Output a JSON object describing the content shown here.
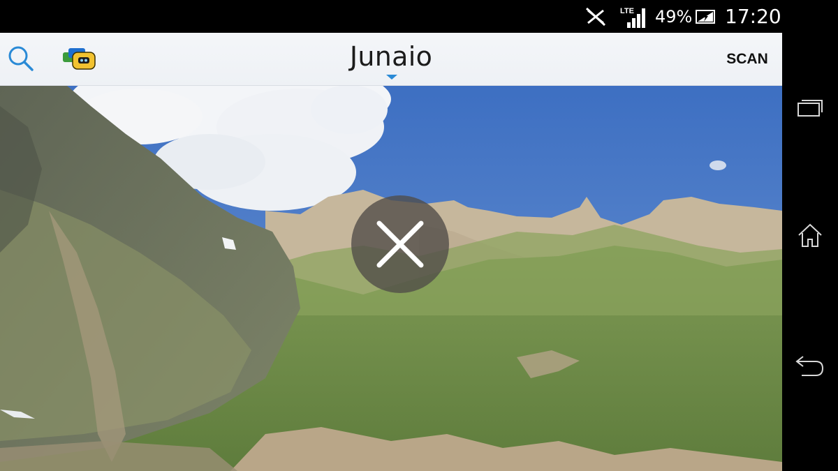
{
  "status_bar": {
    "network_type": "LTE",
    "battery_percent": "49%",
    "time": "17:20",
    "icons": [
      "no-sim-icon",
      "lte-signal-icon",
      "battery-charging-icon"
    ]
  },
  "action_bar": {
    "title": "Junaio",
    "scan_label": "SCAN",
    "icons": [
      "search-icon",
      "channels-icon",
      "title-dropdown-caret-icon"
    ]
  },
  "overlay": {
    "icon": "close-icon"
  },
  "nav_bar": {
    "icons": [
      "recent-apps-icon",
      "home-icon",
      "back-icon"
    ]
  },
  "colors": {
    "accent": "#2a8ad6",
    "action_bar_bg": "#f1f3f7",
    "close_overlay": "#504c48",
    "system_bars": "#000000"
  }
}
